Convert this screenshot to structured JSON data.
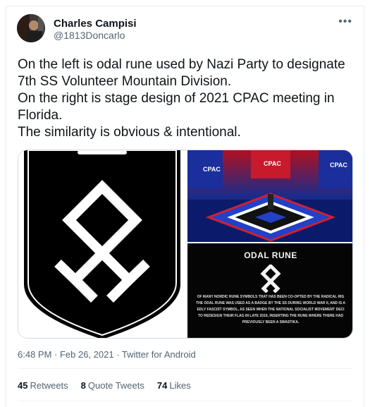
{
  "author": {
    "name": "Charles Campisi",
    "handle": "@1813Doncarlo"
  },
  "tweet": {
    "lines": [
      "On the left is odal rune used by Nazi Party to designate",
      "7th SS Volunteer Mountain Division.",
      "On the right is stage design of 2021 CPAC meeting in",
      "Florida.",
      "The similarity is obvious & intentional."
    ]
  },
  "media": {
    "right_image": {
      "stage_logos": [
        "CPAC",
        "CPAC",
        "CPAC"
      ],
      "title": "ODAL RUNE",
      "caption_lines": [
        "OF MANY NORDIC RUNE SYMBOLS THAT HAS BEEN CO-OPTED BY THE RADICAL RIG",
        "THE ODAL RUNE WAS USED AS A BADGE BY THE SS DURING WORLD WAR II, AND IS A",
        "EDLY FASCIST SYMBOL, AS SEEN WHEN THE NATIONAL SOCIALIST MOVEMENT DECI",
        "TO REDESIGN THEIR FLAG IN LATE 2016, INSERTING THE RUNE WHERE THERE HAD",
        "PREVIOUSLY BEEN A SWASTIKA."
      ]
    }
  },
  "meta": {
    "timestamp": "6:48 PM · Feb 26, 2021 · Twitter for Android"
  },
  "stats": {
    "retweets_count": "45",
    "retweets_label": "Retweets",
    "quotes_count": "8",
    "quotes_label": "Quote Tweets",
    "likes_count": "74",
    "likes_label": "Likes"
  },
  "colors": {
    "text": "#0f1419",
    "secondary": "#536471",
    "border": "#e6ecf0"
  }
}
